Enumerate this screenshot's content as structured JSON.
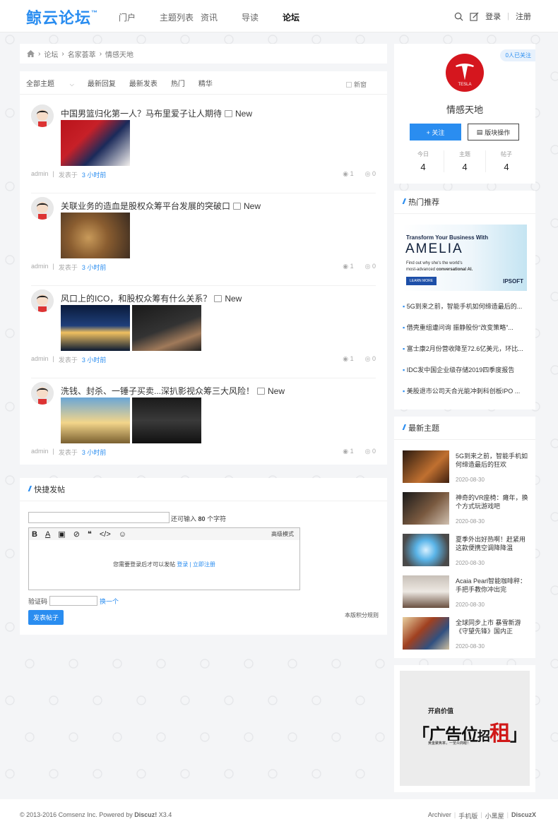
{
  "brand": {
    "logo": "鲸云论坛",
    "tm": "™"
  },
  "nav": [
    "门户",
    "主题列表",
    "资讯",
    "导读",
    "论坛"
  ],
  "header_right": {
    "login": "登录",
    "register": "注册",
    "sep": "|"
  },
  "breadcrumb": [
    "论坛",
    "名家荟萃",
    "情感天地"
  ],
  "tabs": [
    "全部主题",
    "最新回复",
    "最新发表",
    "热门",
    "精华"
  ],
  "new_window": "新窗",
  "posts": [
    {
      "title": "中国男篮归化第一人？马布里爱子让人期待",
      "new": "New",
      "author": "admin",
      "posted": "发表于",
      "time": "3 小时前",
      "views": "1",
      "replies": "0"
    },
    {
      "title": "关联业务的造血是股权众筹平台发展的突破口",
      "new": "New",
      "author": "admin",
      "posted": "发表于",
      "time": "3 小时前",
      "views": "1",
      "replies": "0"
    },
    {
      "title": "风口上的ICO，和股权众筹有什么关系？",
      "new": "New",
      "author": "admin",
      "posted": "发表于",
      "time": "3 小时前",
      "views": "1",
      "replies": "0"
    },
    {
      "title": "洗钱、封杀、一锤子买卖...深扒影视众筹三大风险！",
      "new": "New",
      "author": "admin",
      "posted": "发表于",
      "time": "3 小时前",
      "views": "1",
      "replies": "0"
    }
  ],
  "quick": {
    "title": "快捷发帖",
    "chars_a": "还可输入",
    "chars_n": "80",
    "chars_b": "个字符",
    "advanced": "高级模式",
    "login_need": "您需要登录后才可以发帖",
    "login": "登录",
    "sep": "|",
    "reg": "立即注册",
    "captcha": "验证码",
    "change": "换一个",
    "submit": "发表帖子",
    "rules": "本版积分规则"
  },
  "forum": {
    "follow_count": "0人已关注",
    "name": "情感天地",
    "follow_btn": "+ 关注",
    "ops_btn": "版块操作",
    "stats": [
      {
        "label": "今日",
        "value": "4"
      },
      {
        "label": "主题",
        "value": "4"
      },
      {
        "label": "帖子",
        "value": "4"
      }
    ],
    "logo_text": "TESLA"
  },
  "hot": {
    "title": "热门推荐",
    "banner": {
      "l1": "Transform Your Business With",
      "brand": "AMELIA",
      "l2": "Find out why she's the world's",
      "l3a": "most-advanced ",
      "l3b": "conversational AI.",
      "btn": "LEARN MORE",
      "logo": "IPSOFT"
    },
    "items": [
      "5G到来之前，智能手机如何缔造最后的...",
      "借壳重组遭问询 振静股份“改变策略”...",
      "富士康2月份营收降至72.6亿美元，环比...",
      "IDC发中国企业级存储2019四季度报告",
      "美股退市公司天合光能冲刺科创板IPO ..."
    ]
  },
  "latest": {
    "title": "最新主题",
    "items": [
      {
        "title": "5G到来之前，智能手机如何缔造最后的狂欢",
        "date": "2020-08-30"
      },
      {
        "title": "神奇的VR座椅：瘫年，换个方式玩游戏吧",
        "date": "2020-08-30"
      },
      {
        "title": "夏季外出好热啊！赶紧用这款便携空调降降温",
        "date": "2020-08-30"
      },
      {
        "title": "Acaia Pearl智能咖啡秤：手把手教你冲出完",
        "date": "2020-08-30"
      },
      {
        "title": "全球同步上市 暴雪新游《守望先锋》国内正",
        "date": "2020-08-30"
      }
    ]
  },
  "ad": {
    "top": "开启价值",
    "big1": "广告位",
    "big2": "招",
    "big3": "租",
    "small": "黄金聚焦率，一览众商眼！"
  },
  "footer": {
    "copy": "© 2013-2016 Comsenz Inc. Powered by ",
    "brand": "Discuz!",
    "ver": " X3.4",
    "links": [
      "Archiver",
      "手机版",
      "小黑屋"
    ],
    "right": "DiscuzX"
  }
}
